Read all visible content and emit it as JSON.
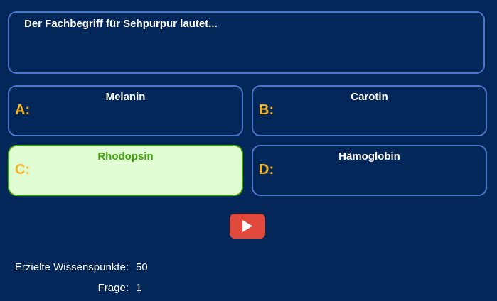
{
  "question": {
    "text": "Der Fachbegriff für Sehpurpur lautet..."
  },
  "answers": [
    {
      "letter": "A:",
      "text": "Melanin"
    },
    {
      "letter": "B:",
      "text": "Carotin"
    },
    {
      "letter": "C:",
      "text": "Rhodopsin"
    },
    {
      "letter": "D:",
      "text": "Hämoglobin"
    }
  ],
  "colors": {
    "background": "#04275a",
    "border": "#4a78c8",
    "letter": "#f5b21c",
    "correct_bg": "#e0fcd3",
    "correct_text": "#3fa00c",
    "play_button": "#e0493c"
  },
  "play_button": {
    "icon": "play-icon"
  },
  "stats": {
    "points_label": "Erzielte Wissenspunkte:",
    "points_value": "50",
    "question_label": "Frage:",
    "question_value": "1"
  }
}
